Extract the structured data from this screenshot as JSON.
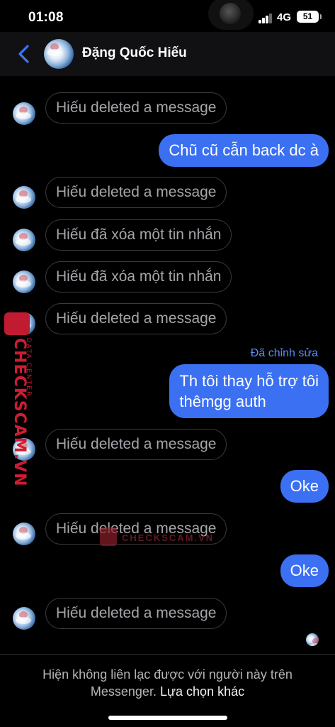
{
  "status": {
    "time": "01:08",
    "network": "4G",
    "battery": "51"
  },
  "header": {
    "contact_name": "Đặng Quốc Hiếu"
  },
  "messages": {
    "m1": "Hiếu deleted a message",
    "m2": "Chũ cũ cẫn back dc à",
    "m3": "Hiếu deleted a message",
    "m4": "Hiếu đã xóa một tin nhắn",
    "m5": "Hiếu đã xóa một tin nhắn",
    "m6": "Hiếu deleted a message",
    "m7_edited": "Đã chỉnh sửa",
    "m7_line1": "Th tôi thay hỗ trợ tôi",
    "m7_line2": "thêmgg auth",
    "m8": "Hiếu deleted a message",
    "m9": "Oke",
    "m10": "Hiếu deleted a message",
    "m11": "Oke",
    "m12": "Hiếu deleted a message"
  },
  "watermark": {
    "brand": "CHECKSCAM.VN",
    "sub": "DATA CENTER",
    "center": "CHECKSCAM.VN"
  },
  "footer": {
    "notice": "Hiện không liên lạc được với người này trên",
    "notice2": "Messenger.",
    "link": "Lựa chọn khác"
  },
  "colors": {
    "accent": "#3b70f2",
    "background": "#000000",
    "watermark": "#d01c32"
  }
}
